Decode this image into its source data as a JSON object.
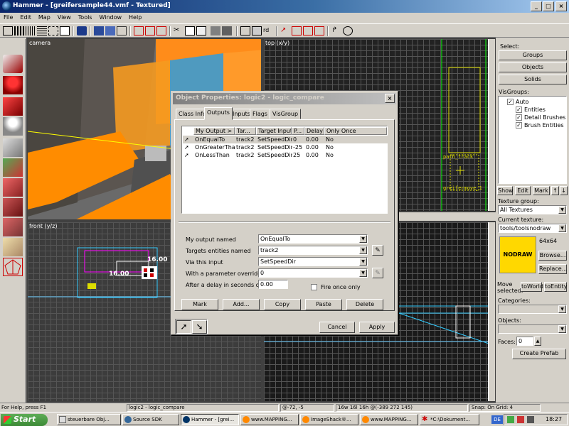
{
  "window": {
    "title": "Hammer - [greifersample44.vmf - Textured]",
    "min": "_",
    "max": "□",
    "close": "×"
  },
  "menu": [
    "File",
    "Edit",
    "Map",
    "View",
    "Tools",
    "Window",
    "Help"
  ],
  "views": {
    "camera": "camera",
    "top": "top (x/y)",
    "front": "front (y/z)",
    "front_label_a": "16.00",
    "front_label_b": "16.00",
    "top_ent_a": "path_track",
    "top_ent_b": "greifermove_1"
  },
  "right": {
    "select_label": "Select:",
    "groups": "Groups",
    "objects": "Objects",
    "solids": "Solids",
    "visgroups_label": "VisGroups:",
    "vis_auto": "Auto",
    "vis_entities": "Entities",
    "vis_detail": "Detail Brushes",
    "vis_brush": "Brush Entities",
    "show": "Show",
    "edit": "Edit",
    "mark": "Mark",
    "up": "↑",
    "down": "↓",
    "texgroup_label": "Texture group:",
    "texgroup_value": "All Textures",
    "curtex_label": "Current texture:",
    "curtex_value": "tools/toolsnodraw",
    "tex_name": "NODRAW",
    "tex_size": "64x64",
    "browse": "Browse...",
    "replace": "Replace...",
    "move_label": "Move selected:",
    "toworld": "toWorld",
    "toentity": "toEntity",
    "categories_label": "Categories:",
    "objects_label": "Objects:",
    "faces_label": "Faces:",
    "faces_value": "0",
    "create_prefab": "Create Prefab"
  },
  "dialog": {
    "title": "Object Properties: logic2 - logic_compare",
    "tabs": [
      "Class Info",
      "Outputs",
      "Inputs",
      "Flags",
      "VisGroup"
    ],
    "columns": [
      "My Output >",
      "Tar...",
      "Target Input",
      "P...",
      "Delay",
      "Only Once"
    ],
    "rows": [
      [
        "OnEqualTo",
        "track2",
        "SetSpeedDir",
        "0",
        "0.00",
        "No"
      ],
      [
        "OnGreaterThan",
        "track2",
        "SetSpeedDir",
        "-25",
        "0.00",
        "No"
      ],
      [
        "OnLessThan",
        "track2",
        "SetSpeedDir",
        "25",
        "0.00",
        "No"
      ]
    ],
    "my_output_label": "My output named",
    "my_output_value": "OnEqualTo",
    "targets_label": "Targets entities named",
    "targets_value": "track2",
    "via_label": "Via this input",
    "via_value": "SetSpeedDir",
    "param_label": "With a parameter override of",
    "param_value": "0",
    "delay_label": "After a delay in seconds of",
    "delay_value": "0.00",
    "fire_once": "Fire once only",
    "buttons": [
      "Mark",
      "Add...",
      "Copy",
      "Paste",
      "Delete"
    ],
    "cancel": "Cancel",
    "apply": "Apply",
    "close": "×"
  },
  "status": {
    "help": "For Help, press F1",
    "object": "logic2 - logic_compare",
    "coords": "@-72, -5",
    "size": "16w 16l 16h @(-389 272 145)",
    "snap": "Snap: On Grid: 4"
  },
  "taskbar": {
    "start": "Start",
    "tasks": [
      "steuerbare Obj...",
      "Source SDK",
      "Hammer - [grei...",
      "www.MAPPING...",
      "ImageShack®...",
      "www.MAPPING...",
      "*C:\\Dokument..."
    ],
    "lang": "DE",
    "clock": "18:27"
  },
  "colors": {
    "accent": "#0a246a",
    "orange": "#ff8c00",
    "nodraw": "#ffd800"
  }
}
